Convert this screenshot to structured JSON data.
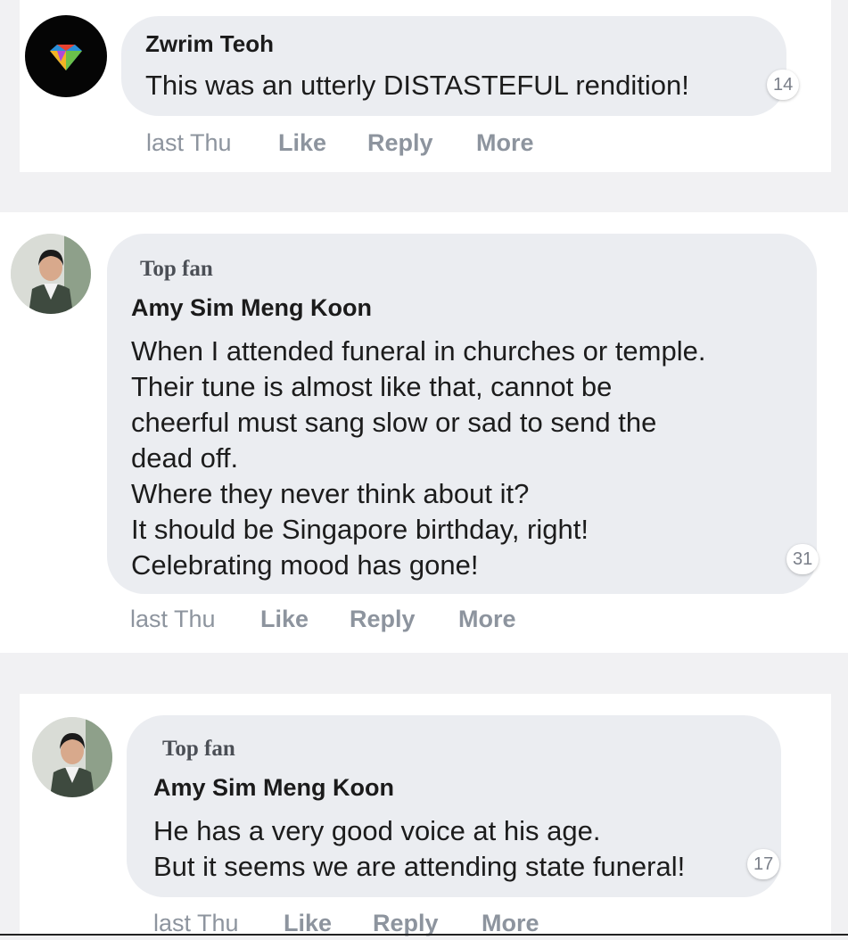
{
  "comments": [
    {
      "author": "Zwrim Teoh",
      "top_fan": "",
      "text": "This was an utterly DISTASTEFUL rendition!",
      "reactions": "14",
      "time": "last Thu",
      "actions": {
        "like": "Like",
        "reply": "Reply",
        "more": "More"
      },
      "avatar_icon": "diamond-avatar-icon"
    },
    {
      "author": "Amy Sim Meng Koon",
      "top_fan": "Top fan",
      "lines": [
        "When I attended funeral in churches or temple.",
        "Their tune is almost like that, cannot be",
        "cheerful must sang slow or sad to send the",
        "dead off.",
        "Where they never think about it?",
        "It should be Singapore birthday, right!",
        "Celebrating mood has gone!"
      ],
      "reactions": "31",
      "time": "last Thu",
      "actions": {
        "like": "Like",
        "reply": "Reply",
        "more": "More"
      },
      "avatar_icon": "person-avatar-icon"
    },
    {
      "author": "Amy Sim Meng Koon",
      "top_fan": "Top fan",
      "lines": [
        "He has a very good voice at his age.",
        "But it seems we are attending state funeral!"
      ],
      "reactions": "17",
      "time": "last Thu",
      "actions": {
        "like": "Like",
        "reply": "Reply",
        "more": "More"
      },
      "avatar_icon": "person-avatar-icon"
    }
  ],
  "colors": {
    "background": "#f1f1f3",
    "bubble": "#ebedf1",
    "action_text": "#8d949e"
  }
}
